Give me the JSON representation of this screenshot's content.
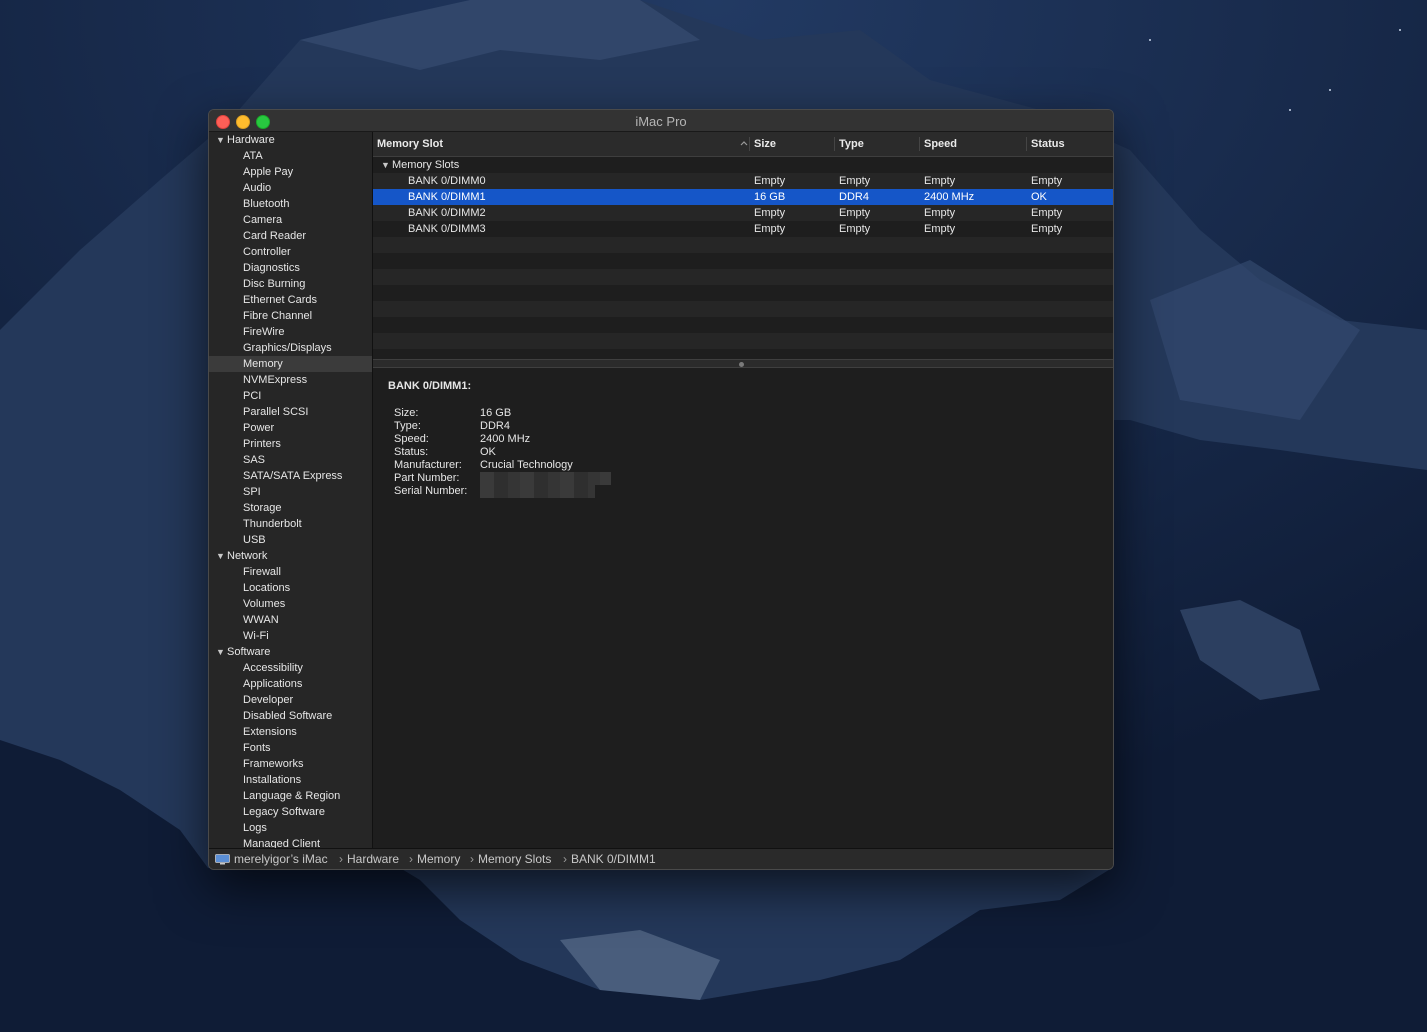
{
  "window": {
    "title": "iMac Pro"
  },
  "sidebar": {
    "selected": "Memory",
    "groups": [
      {
        "label": "Hardware",
        "items": [
          "ATA",
          "Apple Pay",
          "Audio",
          "Bluetooth",
          "Camera",
          "Card Reader",
          "Controller",
          "Diagnostics",
          "Disc Burning",
          "Ethernet Cards",
          "Fibre Channel",
          "FireWire",
          "Graphics/Displays",
          "Memory",
          "NVMExpress",
          "PCI",
          "Parallel SCSI",
          "Power",
          "Printers",
          "SAS",
          "SATA/SATA Express",
          "SPI",
          "Storage",
          "Thunderbolt",
          "USB"
        ]
      },
      {
        "label": "Network",
        "items": [
          "Firewall",
          "Locations",
          "Volumes",
          "WWAN",
          "Wi-Fi"
        ]
      },
      {
        "label": "Software",
        "items": [
          "Accessibility",
          "Applications",
          "Developer",
          "Disabled Software",
          "Extensions",
          "Fonts",
          "Frameworks",
          "Installations",
          "Language & Region",
          "Legacy Software",
          "Logs",
          "Managed Client"
        ]
      }
    ]
  },
  "table": {
    "columns": [
      "Memory Slot",
      "Size",
      "Type",
      "Speed",
      "Status"
    ],
    "group_label": "Memory Slots",
    "selected_index": 1,
    "rows": [
      [
        "BANK 0/DIMM0",
        "Empty",
        "Empty",
        "Empty",
        "Empty"
      ],
      [
        "BANK 0/DIMM1",
        "16 GB",
        "DDR4",
        "2400 MHz",
        "OK"
      ],
      [
        "BANK 0/DIMM2",
        "Empty",
        "Empty",
        "Empty",
        "Empty"
      ],
      [
        "BANK 0/DIMM3",
        "Empty",
        "Empty",
        "Empty",
        "Empty"
      ]
    ]
  },
  "detail": {
    "title": "BANK 0/DIMM1:",
    "fields": [
      {
        "key": "Size:",
        "value": "16 GB"
      },
      {
        "key": "Type:",
        "value": "DDR4"
      },
      {
        "key": "Speed:",
        "value": "2400 MHz"
      },
      {
        "key": "Status:",
        "value": "OK"
      },
      {
        "key": "Manufacturer:",
        "value": "Crucial Technology"
      },
      {
        "key": "Part Number:",
        "value": ""
      },
      {
        "key": "Serial Number:",
        "value": ""
      }
    ]
  },
  "pathbar": {
    "crumbs": [
      "merelyigor’s iMac",
      "Hardware",
      "Memory",
      "Memory Slots",
      "BANK 0/DIMM1"
    ],
    "separator": "›"
  },
  "colors": {
    "selection": "#1556c8",
    "window_bg": "#1e1e1e",
    "sidebar_bg": "#262626",
    "close": "#fe5f57",
    "minimize": "#febc2e",
    "zoom": "#28c840"
  }
}
